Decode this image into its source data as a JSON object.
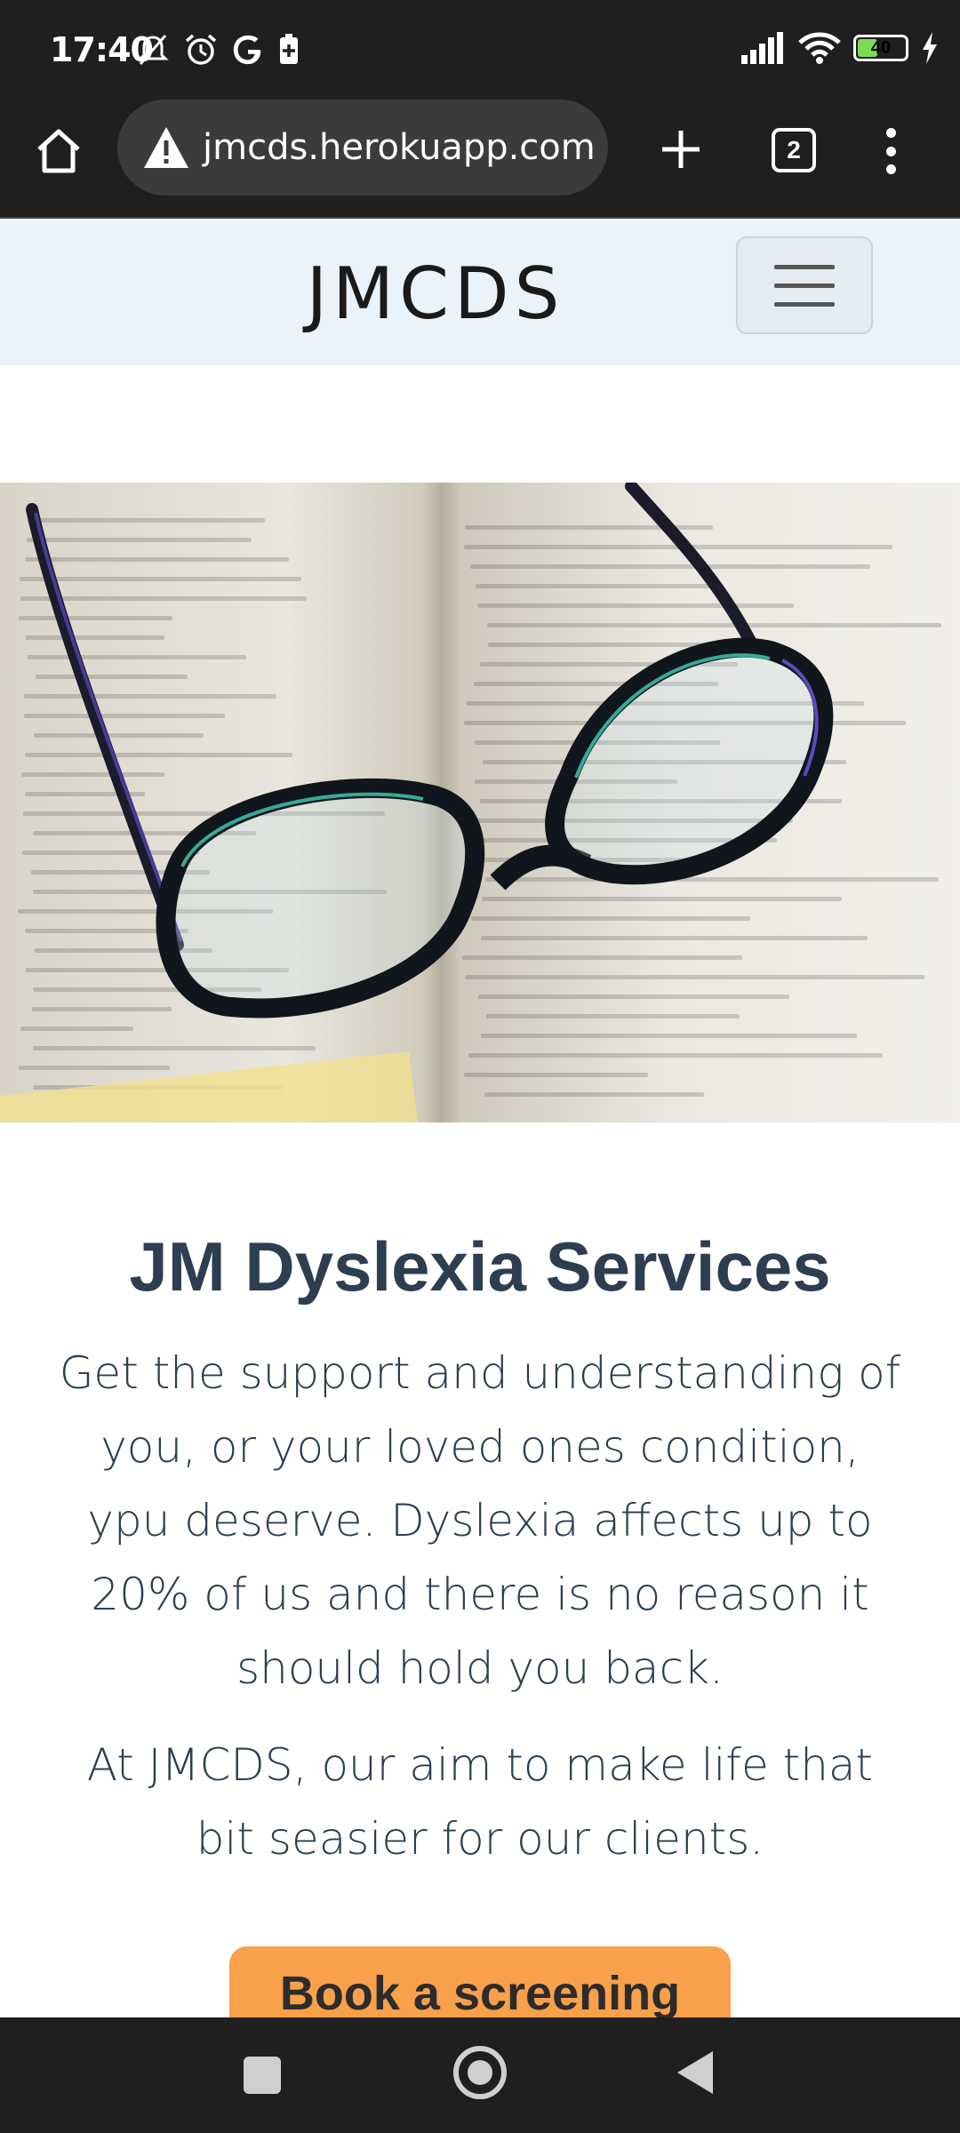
{
  "status_bar": {
    "time": "17:40",
    "battery_level": "40",
    "icons_left": [
      "mute-icon",
      "alarm-icon",
      "google-icon",
      "battery-saver-icon"
    ],
    "icons_right": [
      "signal-icon",
      "wifi-icon",
      "battery-icon",
      "charging-icon"
    ]
  },
  "browser": {
    "url": "jmcds.herokuapp.com",
    "tab_count": "2",
    "icons": [
      "home-icon",
      "warning-icon",
      "plus-icon",
      "tabs-icon",
      "overflow-menu-icon"
    ]
  },
  "site": {
    "brand": "JMCDS",
    "menu_icon": "hamburger-icon"
  },
  "hero": {
    "image_subject": "glasses-on-open-book"
  },
  "content": {
    "headline": "JM Dyslexia Services",
    "paragraph_1": "Get the support and understanding of you, or your loved ones condition, ypu deserve. Dyslexia affects up to 20% of us and there is no reason it should hold you back.",
    "paragraph_2": "At JMCDS, our aim to make life that bit seasier for our clients.",
    "cta_label": "Book a screening"
  },
  "colors": {
    "headline": "#2c3e50",
    "cta_background": "#f9a04b",
    "navbar_background": "#eaf3f9",
    "chrome_background": "#1f1f1f"
  },
  "system_nav": {
    "icons": [
      "recents-icon",
      "home-circle-icon",
      "back-icon"
    ]
  }
}
